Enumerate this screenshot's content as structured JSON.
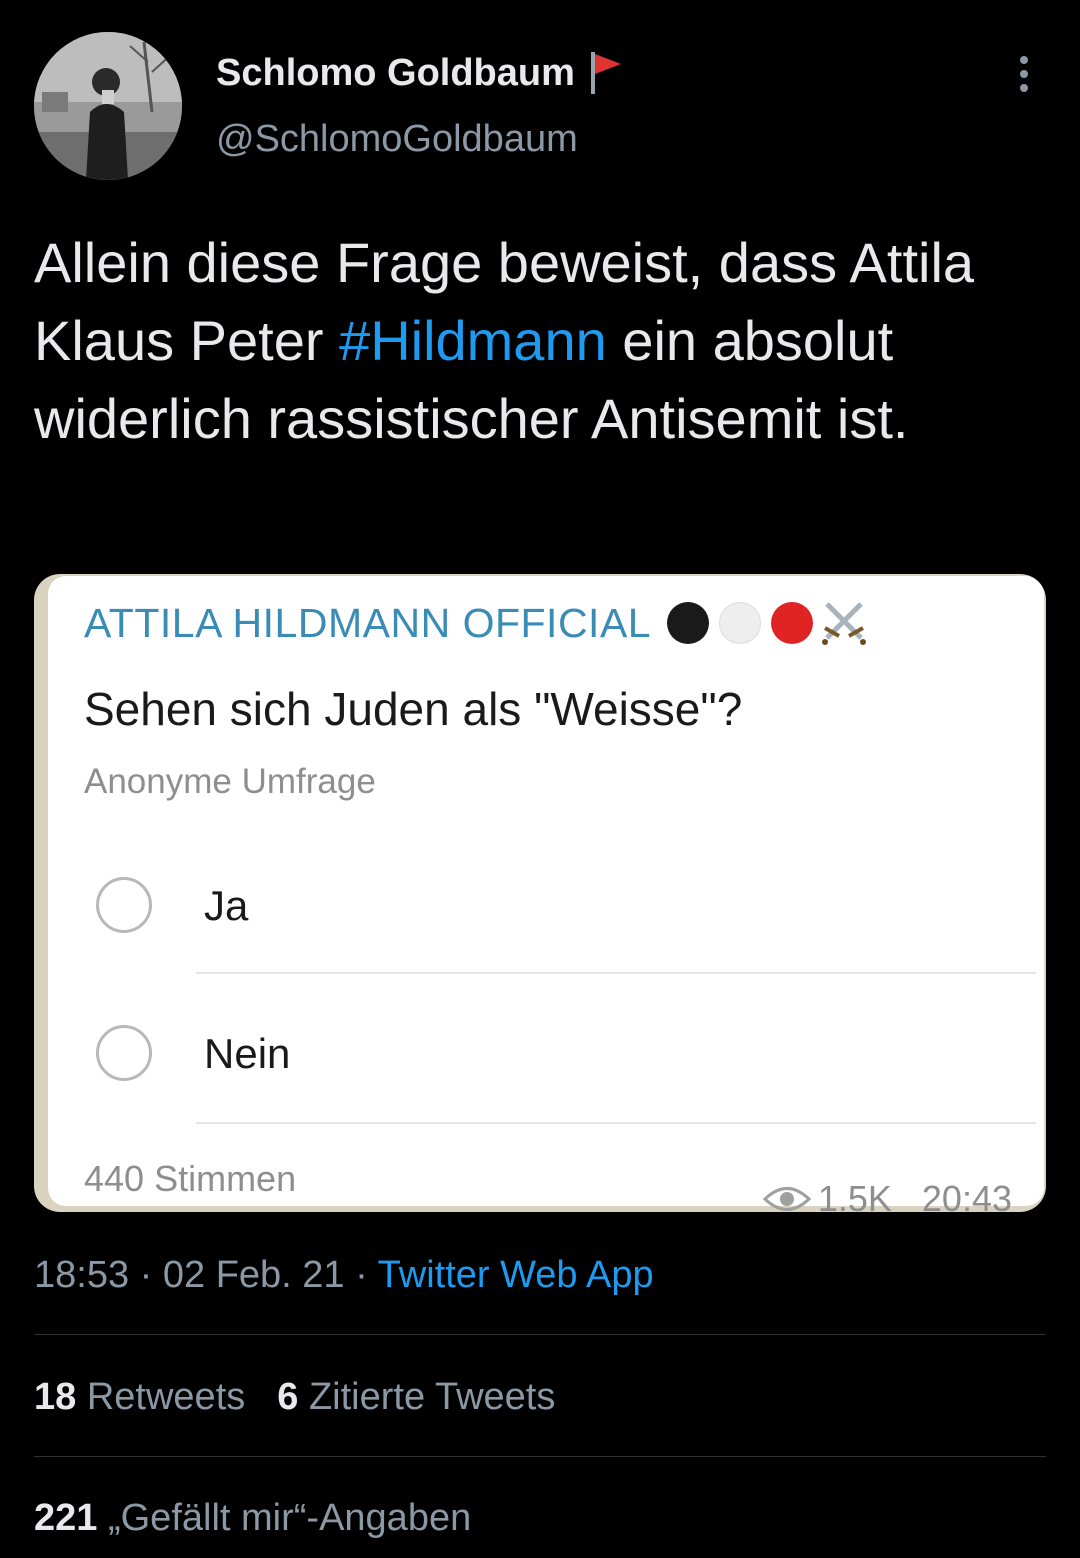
{
  "author": {
    "display_name": "Schlomo Goldbaum",
    "handle": "@SchlomoGoldbaum",
    "flag_emoji": "red-flag"
  },
  "tweet": {
    "text_before": "Allein diese Frage beweist, dass Attila Klaus Peter ",
    "hashtag": "#Hildmann",
    "text_after": " ein absolut widerlich rassistischer Antisemit ist."
  },
  "poll_screenshot": {
    "channel_name": "ATTILA HILDMANN OFFICIAL",
    "channel_emojis": [
      "black-circle",
      "white-circle",
      "red-circle",
      "crossed-swords"
    ],
    "question": "Sehen sich Juden als \"Weisse\"?",
    "poll_type": "Anonyme Umfrage",
    "options": [
      {
        "label": "Ja"
      },
      {
        "label": "Nein"
      }
    ],
    "votes": "440 Stimmen",
    "views": "1.5K",
    "time": "20:43"
  },
  "meta": {
    "time": "18:53",
    "separator": " · ",
    "date": "02 Feb. 21",
    "source": "Twitter Web App"
  },
  "stats": {
    "retweets_count": "18",
    "retweets_label": "Retweets",
    "quotes_count": "6",
    "quotes_label": "Zitierte Tweets",
    "likes_count": "221",
    "likes_label": "„Gefällt mir“-Angaben"
  },
  "colors": {
    "background": "#000000",
    "link": "#1d9bf0",
    "secondary_text": "#8b98a5",
    "channel_name": "#3b8cb5"
  }
}
